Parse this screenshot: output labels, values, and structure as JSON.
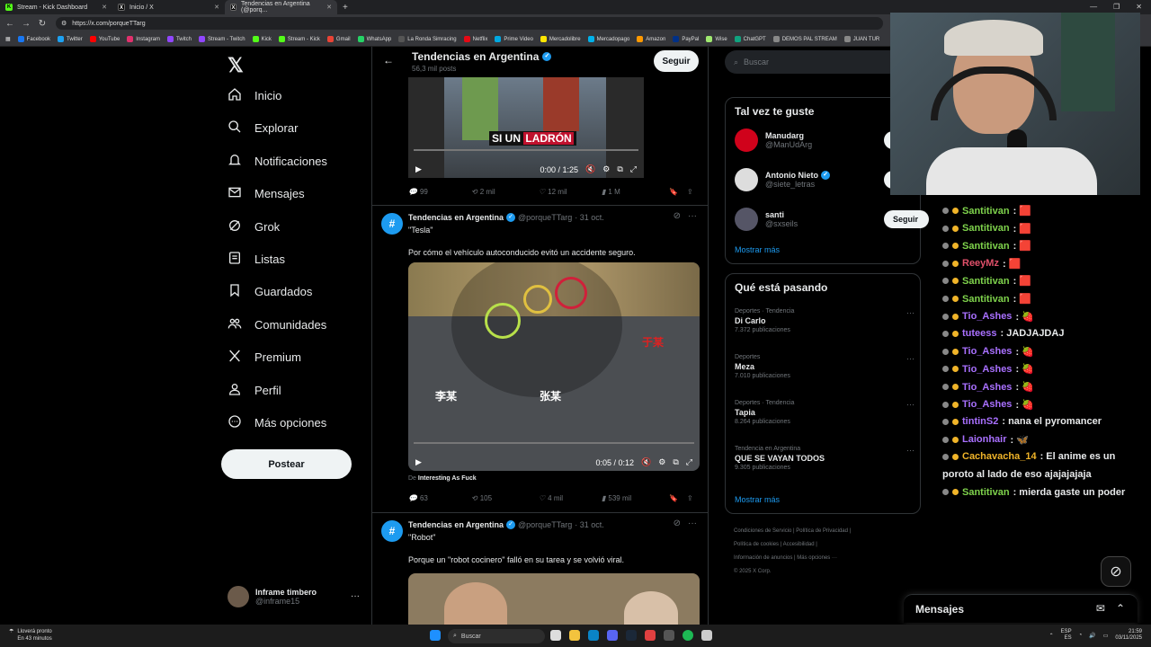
{
  "browser": {
    "tabs": [
      {
        "label": "Stream - Kick Dashboard"
      },
      {
        "label": "Inicio / X"
      },
      {
        "label": "Tendencias en Argentina (@porq..."
      }
    ],
    "url": "https://x.com/porqueTTarg",
    "bookmarks": [
      "Facebook",
      "Twitter",
      "YouTube",
      "Instagram",
      "Twitch",
      "Stream - Twitch",
      "Kick",
      "Stream - Kick",
      "Gmail",
      "WhatsApp",
      "La Ronda Simracing",
      "Netflix",
      "Prime Video",
      "Mercadolibre",
      "Mercadopago",
      "Amazon",
      "PayPal",
      "Wise",
      "ChatGPT",
      "DEMOS PAL STREAM",
      "JUAN TUR"
    ]
  },
  "nav": {
    "items": [
      {
        "label": "Inicio",
        "icon": "home-icon"
      },
      {
        "label": "Explorar",
        "icon": "search-icon"
      },
      {
        "label": "Notificaciones",
        "icon": "bell-icon"
      },
      {
        "label": "Mensajes",
        "icon": "mail-icon"
      },
      {
        "label": "Grok",
        "icon": "grok-icon"
      },
      {
        "label": "Listas",
        "icon": "list-icon"
      },
      {
        "label": "Guardados",
        "icon": "bookmark-icon"
      },
      {
        "label": "Comunidades",
        "icon": "people-icon"
      },
      {
        "label": "Premium",
        "icon": "x-icon"
      },
      {
        "label": "Perfil",
        "icon": "person-icon"
      },
      {
        "label": "Más opciones",
        "icon": "more-circle-icon"
      }
    ],
    "post_label": "Postear",
    "profile": {
      "name": "Inframe timbero",
      "handle": "@inframe15"
    }
  },
  "header": {
    "title": "Tendencias en Argentina",
    "subtitle": "56,3 mil posts",
    "follow_label": "Seguir"
  },
  "tweet0": {
    "caption_pre": "SI UN",
    "caption_hl": "LADRÓN",
    "time": "0:00 / 1:25",
    "replies": "99",
    "reposts": "2 mil",
    "likes": "12 mil",
    "views": "1 M"
  },
  "tweet1": {
    "name": "Tendencias en Argentina",
    "handle": "@porqueTTarg",
    "date": "· 31 oct.",
    "title": "\"Tesla\"",
    "text": "Por cómo el vehículo autoconducido evitó un accidente seguro.",
    "time": "0:05 / 0:12",
    "overlay_a": "于某",
    "overlay_b": "李某",
    "overlay_c": "张某",
    "source_prefix": "De",
    "source": "Interesting As Fuck",
    "replies": "63",
    "reposts": "105",
    "likes": "4 mil",
    "views": "539 mil"
  },
  "tweet2": {
    "name": "Tendencias en Argentina",
    "handle": "@porqueTTarg",
    "date": "· 31 oct.",
    "title": "\"Robot\"",
    "text": "Porque un \"robot cocinero\" falló en su tarea y se volvió viral."
  },
  "search": {
    "placeholder": "Buscar"
  },
  "who": {
    "title": "Tal vez te guste",
    "items": [
      {
        "name": "Manudarg",
        "handle": "@ManUdArg",
        "color": "#d0021b"
      },
      {
        "name": "Antonio Nieto",
        "handle": "@siete_letras",
        "color": "#ddd"
      },
      {
        "name": "santi",
        "handle": "@sxseils",
        "color": "#556"
      }
    ],
    "follow_label": "Seguir",
    "more": "Mostrar más"
  },
  "trends": {
    "title": "Qué está pasando",
    "items": [
      {
        "cat": "Deportes · Tendencia",
        "name": "Di Carlo",
        "posts": "7.372 publicaciones"
      },
      {
        "cat": "Deportes",
        "name": "Meza",
        "posts": "7.010 publicaciones"
      },
      {
        "cat": "Deportes · Tendencia",
        "name": "Tapia",
        "posts": "8.264 publicaciones"
      },
      {
        "cat": "Tendencia en Argentina",
        "name": "QUE SE VAYAN TODOS",
        "posts": "9.305 publicaciones"
      }
    ],
    "more": "Mostrar más"
  },
  "footer": {
    "l1": "Condiciones de Servicio  |  Política de Privacidad  |",
    "l2": "Política de cookies  |  Accesibilidad  |",
    "l3": "Información de anuncios  |  Más opciones ···",
    "l4": "© 2025 X Corp."
  },
  "chat": [
    {
      "user": "Santitivan",
      "msg": ": 🟥",
      "color": "#7fd34c"
    },
    {
      "user": "Santitivan",
      "msg": ": 🟥",
      "color": "#7fd34c"
    },
    {
      "user": "Santitivan",
      "msg": ": 🟥",
      "color": "#7fd34c"
    },
    {
      "user": "ReeyMz",
      "msg": ": 🟥",
      "color": "#e0506a"
    },
    {
      "user": "Santitivan",
      "msg": ": 🟥",
      "color": "#7fd34c"
    },
    {
      "user": "Santitivan",
      "msg": ": 🟥",
      "color": "#7fd34c"
    },
    {
      "user": "Tio_Ashes",
      "msg": ": 🍓",
      "color": "#a970ff"
    },
    {
      "user": "tuteess",
      "msg": ": JADJAJDAJ",
      "color": "#a970ff"
    },
    {
      "user": "Tio_Ashes",
      "msg": ": 🍓",
      "color": "#a970ff"
    },
    {
      "user": "Tio_Ashes",
      "msg": ": 🍓",
      "color": "#a970ff"
    },
    {
      "user": "Tio_Ashes",
      "msg": ": 🍓",
      "color": "#a970ff"
    },
    {
      "user": "Tio_Ashes",
      "msg": ": 🍓",
      "color": "#a970ff"
    },
    {
      "user": "tintinS2",
      "msg": ": nana el pyromancer",
      "color": "#a970ff"
    },
    {
      "user": "Laionhair",
      "msg": ": 🦋",
      "color": "#a970ff"
    },
    {
      "user": "Cachavacha_14",
      "msg": ": El anime es un",
      "color": "#f0b429"
    },
    {
      "user": "",
      "msg": "poroto al lado de eso ajajajajaja",
      "color": "#fff"
    },
    {
      "user": "Santitivan",
      "msg": ": mierda gaste un poder",
      "color": "#7fd34c"
    }
  ],
  "messages_label": "Mensajes",
  "taskbar": {
    "weather1": "Lloverá pronto",
    "weather2": "En 43 minutos",
    "search": "Buscar",
    "lang1": "ESP",
    "lang2": "ES",
    "time": "21:59",
    "date": "03/11/2025"
  }
}
